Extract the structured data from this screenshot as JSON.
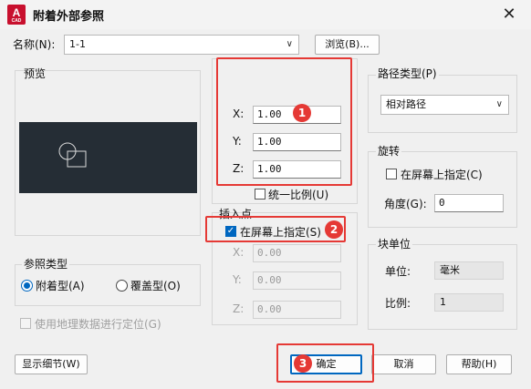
{
  "window": {
    "title": "附着外部参照",
    "icon_letter": "A",
    "icon_sub": "CAD",
    "close_glyph": "✕"
  },
  "name_row": {
    "label": "名称(N):",
    "value": "1-1",
    "browse_label": "浏览(B)..."
  },
  "preview": {
    "label": "预览"
  },
  "scale": {
    "x_label": "X:",
    "x_value": "1.00",
    "y_label": "Y:",
    "y_value": "1.00",
    "z_label": "Z:",
    "z_value": "1.00",
    "uniform_label": "统一比例(U)",
    "uniform_checked": false
  },
  "insertion": {
    "label": "插入点",
    "on_screen_label": "在屏幕上指定(S)",
    "on_screen_checked": true,
    "x_label": "X:",
    "x_value": "0.00",
    "y_label": "Y:",
    "y_value": "0.00",
    "z_label": "Z:",
    "z_value": "0.00"
  },
  "path_type": {
    "label": "路径类型(P)",
    "value": "相对路径"
  },
  "rotation": {
    "label": "旋转",
    "on_screen_label": "在屏幕上指定(C)",
    "on_screen_checked": false,
    "angle_label": "角度(G):",
    "angle_value": "0"
  },
  "block_unit": {
    "label": "块单位",
    "unit_label": "单位:",
    "unit_value": "毫米",
    "scale_label": "比例:",
    "scale_value": "1"
  },
  "ref_type": {
    "label": "参照类型",
    "attach_label": "附着型(A)",
    "overlay_label": "覆盖型(O)",
    "selected": "attach"
  },
  "geo_label": "使用地理数据进行定位(G)",
  "buttons": {
    "details": "显示细节(W)",
    "ok": "确定",
    "cancel": "取消",
    "help": "帮助(H)"
  },
  "annotations": {
    "badge1": "1",
    "badge2": "2",
    "badge3": "3",
    "color": "#e53935"
  },
  "colors": {
    "accent": "#0067c0",
    "preview_bg": "#252d35",
    "brand": "#c8102e"
  }
}
